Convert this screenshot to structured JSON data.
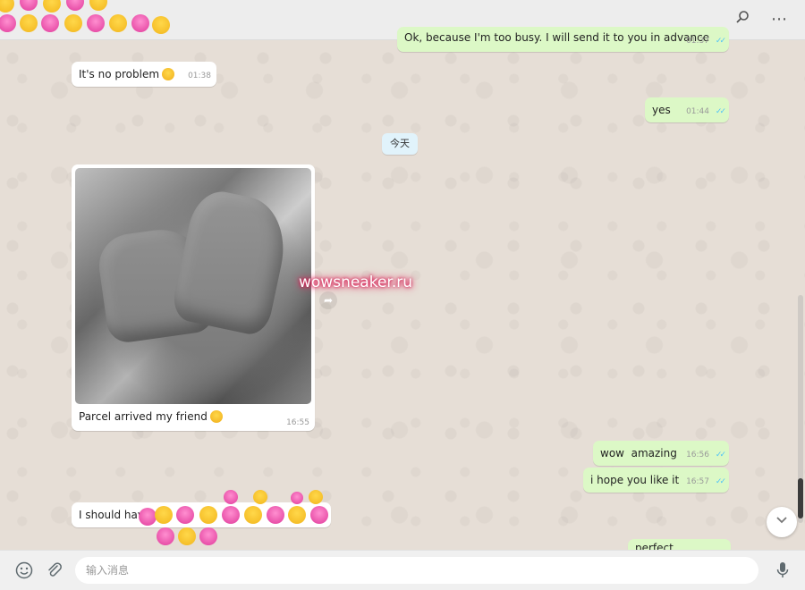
{
  "header": {
    "search_icon": "search-icon",
    "menu_icon": "more-options-icon",
    "menu_glyph": "⋯"
  },
  "messages": [
    {
      "id": "m1",
      "direction": "out",
      "text": "Ok, because I'm too busy. I will send it to you in advance",
      "time": "01:37",
      "ticks": "✓✓"
    },
    {
      "id": "m2",
      "direction": "in",
      "text": "It's no problem",
      "time": "01:38",
      "emoji": "smiling-face"
    },
    {
      "id": "m3",
      "direction": "out",
      "text": "yes",
      "time": "01:44",
      "ticks": "✓✓"
    },
    {
      "id": "m5",
      "direction": "out",
      "text": "wow  amazing",
      "time": "16:56",
      "ticks": "✓✓"
    },
    {
      "id": "m6",
      "direction": "out",
      "text": "i hope you like it",
      "time": "16:57",
      "ticks": "✓✓"
    },
    {
      "id": "m7",
      "direction": "in",
      "text": "I should have",
      "time": ""
    },
    {
      "id": "m8",
      "direction": "out",
      "text": "perfect",
      "time": ""
    }
  ],
  "date_divider": "今天",
  "photo_message": {
    "caption": "Parcel arrived my friend",
    "time": "16:55",
    "emoji": "smiling-face",
    "forward_icon": "forward-icon"
  },
  "watermark": "wowsneaker.ru",
  "footer": {
    "placeholder": "输入消息",
    "emoji_icon": "emoji-icon",
    "attach_icon": "paperclip-icon",
    "mic_icon": "microphone-icon"
  },
  "colors": {
    "outgoing_bubble": "#dcf8c6",
    "incoming_bubble": "#ffffff",
    "chat_background": "#e6ded6",
    "read_ticks": "#4fc3f7",
    "watermark_glow": "#e0245e"
  }
}
